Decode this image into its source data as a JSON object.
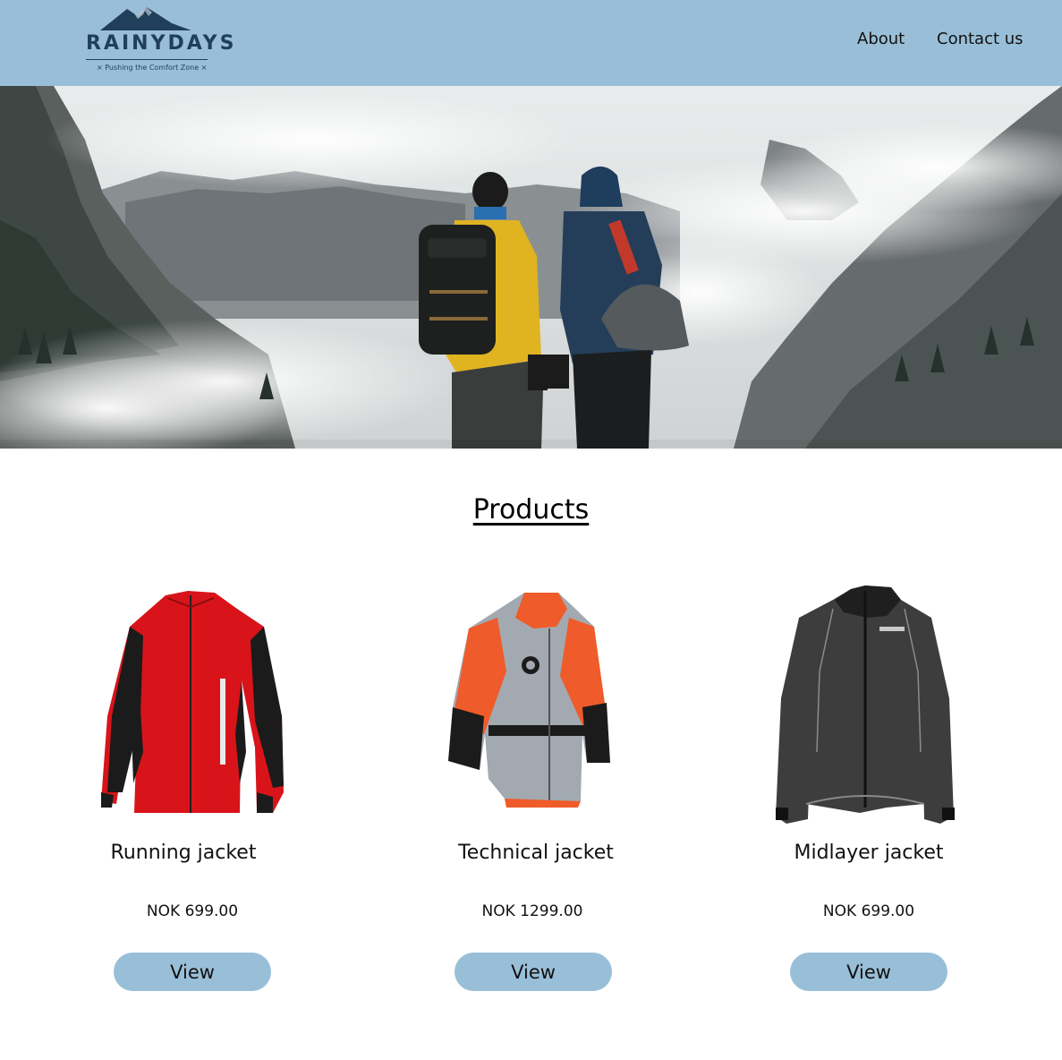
{
  "header": {
    "logo": {
      "name": "RAINYDAYS",
      "tagline": "× Pushing the Comfort Zone ×"
    },
    "nav": [
      {
        "label": "About"
      },
      {
        "label": "Contact us"
      }
    ]
  },
  "main": {
    "section_title": "Products",
    "products": [
      {
        "name": "Running jacket",
        "price": "NOK 699.00",
        "button": "View",
        "image_icon": "red-running-jacket-image"
      },
      {
        "name": "Technical jacket",
        "price": "NOK 1299.00",
        "button": "View",
        "image_icon": "orange-technical-jacket-image"
      },
      {
        "name": "Midlayer jacket",
        "price": "NOK 699.00",
        "button": "View",
        "image_icon": "grey-midlayer-jacket-image"
      }
    ]
  },
  "colors": {
    "header_bg": "#99bfd8",
    "button_bg": "#99bfd8",
    "logo": "#1f3f5a"
  }
}
